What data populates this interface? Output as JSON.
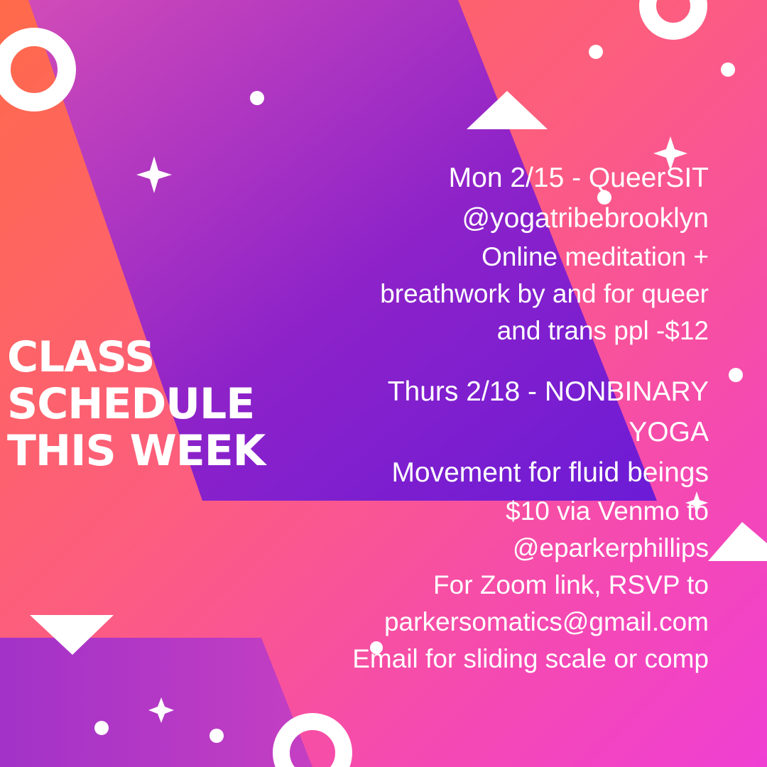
{
  "heading": {
    "line1": "CLASS",
    "line2": "SCHEDULE",
    "line3": "THIS WEEK"
  },
  "class1": {
    "title": "Mon 2/15 - QueerSIT",
    "host": "@yogatribebrooklyn",
    "desc1": "Online meditation +",
    "desc2": "breathwork by and for queer",
    "desc3": "and trans ppl -$12"
  },
  "class2": {
    "title": "Thurs 2/18 - NONBINARY",
    "title2": "YOGA",
    "tagline": "Movement for fluid beings",
    "price": "$10 via Venmo to",
    "venmo": "@eparkerphillips",
    "rsvp": "For Zoom link, RSVP to",
    "email": "parkersomatics@gmail.com",
    "note": "Email for sliding scale or comp"
  },
  "colors": {
    "purple": "#7a1fd0",
    "coral": "#ff6a4a",
    "pink": "#f54ab0",
    "white": "#ffffff"
  }
}
